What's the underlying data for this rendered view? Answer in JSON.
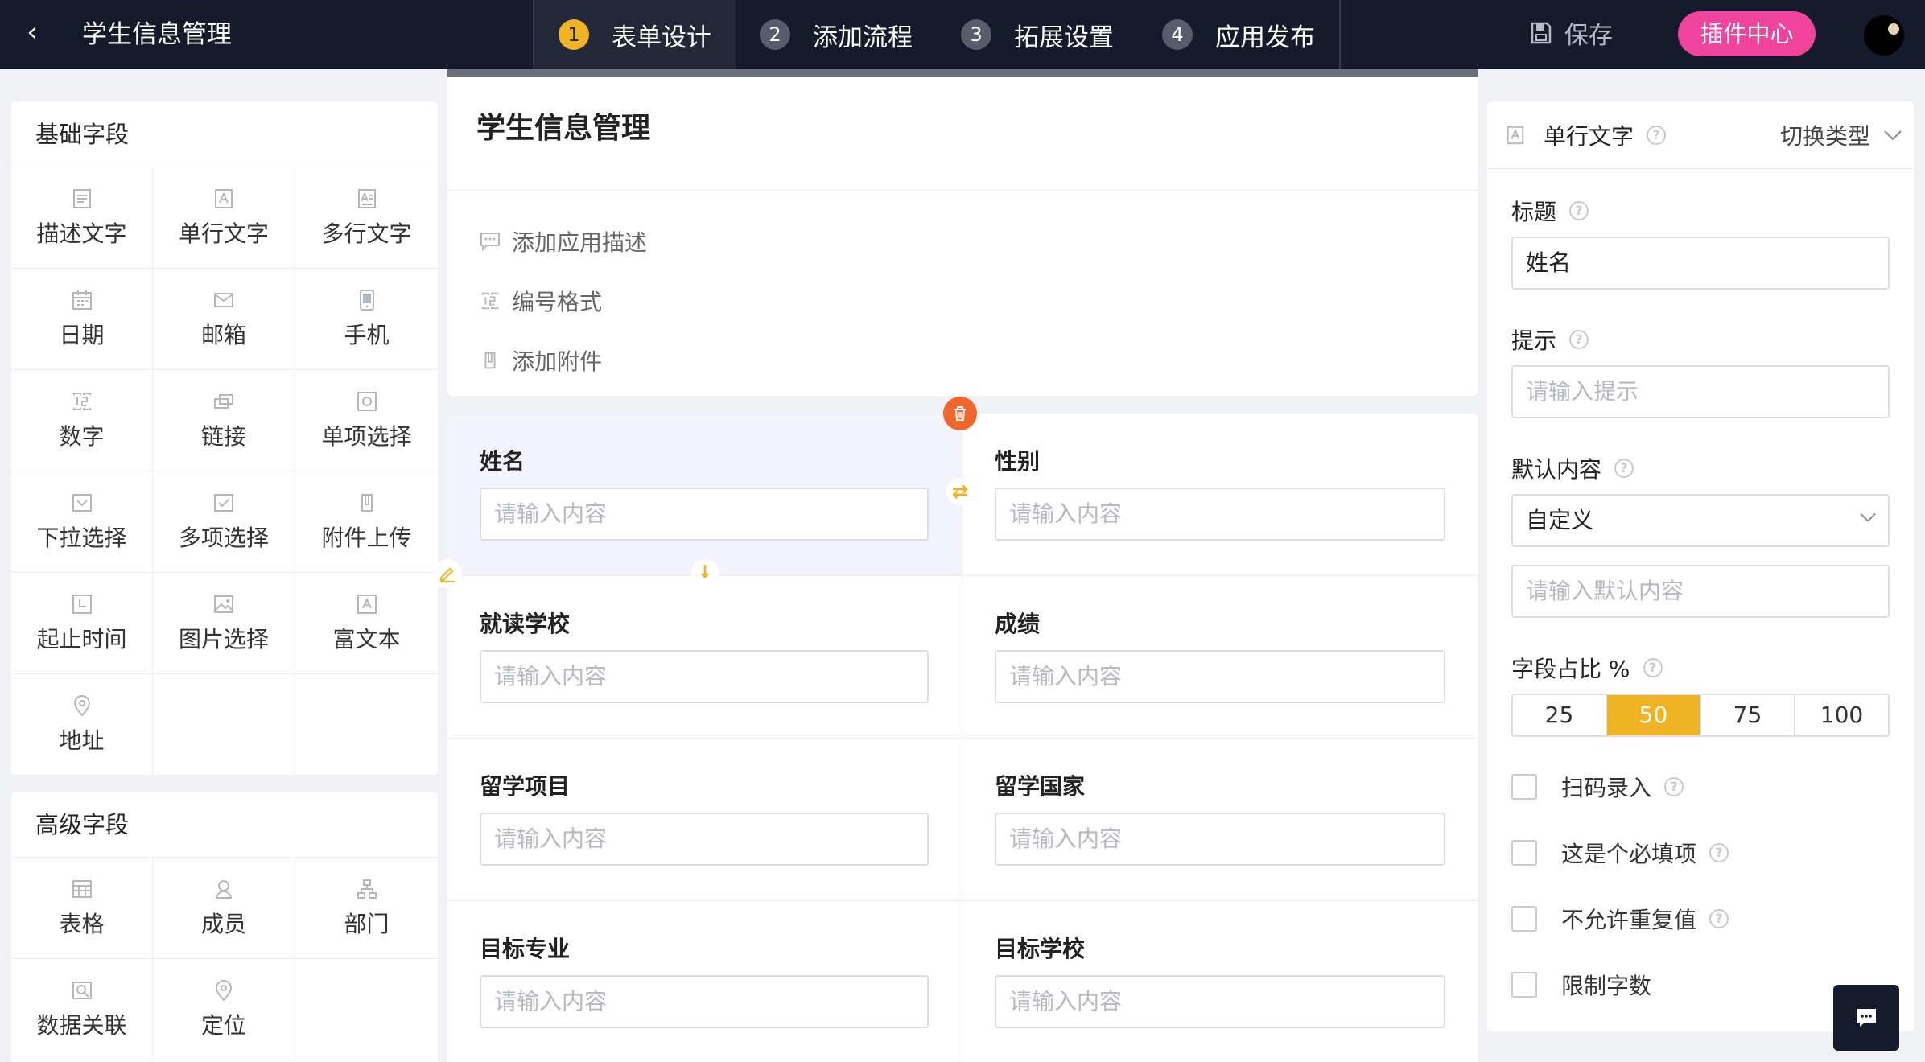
{
  "topbar": {
    "back_icon": "chevron-left-icon",
    "app_title": "学生信息管理",
    "steps": [
      {
        "num": "1",
        "label": "表单设计",
        "active": true
      },
      {
        "num": "2",
        "label": "添加流程",
        "active": false
      },
      {
        "num": "3",
        "label": "拓展设置",
        "active": false
      },
      {
        "num": "4",
        "label": "应用发布",
        "active": false
      }
    ],
    "save_label": "保存",
    "plugin_label": "插件中心"
  },
  "basic_fields": {
    "title": "基础字段",
    "items": [
      {
        "label": "描述文字",
        "icon": "text-lines-icon"
      },
      {
        "label": "单行文字",
        "icon": "single-line-text-icon"
      },
      {
        "label": "多行文字",
        "icon": "multi-line-text-icon"
      },
      {
        "label": "日期",
        "icon": "calendar-icon"
      },
      {
        "label": "邮箱",
        "icon": "mail-icon"
      },
      {
        "label": "手机",
        "icon": "phone-icon"
      },
      {
        "label": "数字",
        "icon": "number-icon"
      },
      {
        "label": "链接",
        "icon": "link-icon"
      },
      {
        "label": "单项选择",
        "icon": "radio-icon"
      },
      {
        "label": "下拉选择",
        "icon": "dropdown-icon"
      },
      {
        "label": "多项选择",
        "icon": "checkbox-icon"
      },
      {
        "label": "附件上传",
        "icon": "attachment-icon"
      },
      {
        "label": "起止时间",
        "icon": "time-range-icon"
      },
      {
        "label": "图片选择",
        "icon": "image-icon"
      },
      {
        "label": "富文本",
        "icon": "rich-text-icon"
      },
      {
        "label": "地址",
        "icon": "location-pin-icon"
      }
    ]
  },
  "advanced_fields": {
    "title": "高级字段",
    "items": [
      {
        "label": "表格",
        "icon": "table-icon"
      },
      {
        "label": "成员",
        "icon": "user-icon"
      },
      {
        "label": "部门",
        "icon": "org-chart-icon"
      },
      {
        "label": "数据关联",
        "icon": "data-link-icon"
      },
      {
        "label": "定位",
        "icon": "location-pin-icon"
      }
    ]
  },
  "form": {
    "title": "学生信息管理",
    "links": [
      "添加应用描述",
      "编号格式",
      "添加附件"
    ],
    "input_placeholder": "请输入内容",
    "fields": [
      {
        "label": "姓名",
        "placeholder": "请输入内容"
      },
      {
        "label": "性别",
        "placeholder": "请输入内容"
      },
      {
        "label": "就读学校",
        "placeholder": "请输入内容"
      },
      {
        "label": "成绩",
        "placeholder": "请输入内容"
      },
      {
        "label": "留学项目",
        "placeholder": "请输入内容"
      },
      {
        "label": "留学国家",
        "placeholder": "请输入内容"
      },
      {
        "label": "目标专业",
        "placeholder": "请输入内容"
      },
      {
        "label": "目标学校",
        "placeholder": "请输入内容"
      }
    ],
    "selected_field": "姓名"
  },
  "props": {
    "type_label": "单行文字",
    "switch_type_label": "切换类型",
    "title_label": "标题",
    "title_value": "姓名",
    "hint_label": "提示",
    "hint_placeholder": "请输入提示",
    "default_label": "默认内容",
    "default_select_value": "自定义",
    "default_placeholder": "请输入默认内容",
    "width_label": "字段占比 %",
    "width_options": [
      "25",
      "50",
      "75",
      "100"
    ],
    "width_selected": "50",
    "checkboxes": [
      {
        "label": "扫码录入",
        "help": true,
        "checked": false
      },
      {
        "label": "这是个必填项",
        "help": true,
        "checked": false
      },
      {
        "label": "不允许重复值",
        "help": true,
        "checked": false
      },
      {
        "label": "限制字数",
        "help": false,
        "checked": false
      }
    ]
  },
  "colors": {
    "topbar_bg": "#151a2d",
    "accent": "#f0b323",
    "plugin_pink": "#f0439d",
    "delete_orange": "#f0662c"
  }
}
